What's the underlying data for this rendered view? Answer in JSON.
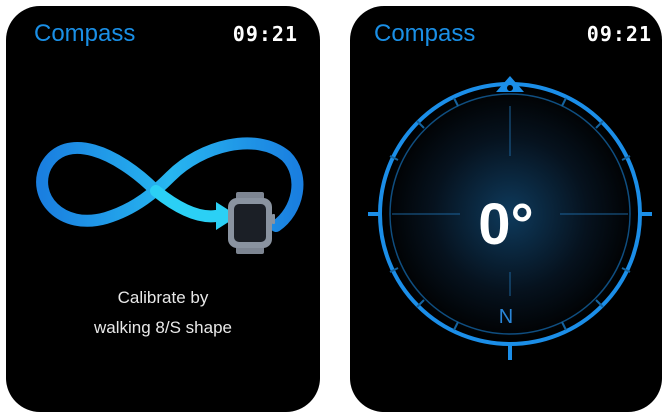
{
  "screens": [
    {
      "app_title": "Compass",
      "time": "09:21",
      "instruction_line1": "Calibrate by",
      "instruction_line2": "walking 8/S shape",
      "icon": "figure-eight-path-with-watch"
    },
    {
      "app_title": "Compass",
      "time": "09:21",
      "heading": "0°",
      "direction": "N",
      "icon": "compass-dial"
    }
  ],
  "colors": {
    "accent": "#1a8fe6",
    "background": "#000000",
    "text": "#ffffff"
  }
}
